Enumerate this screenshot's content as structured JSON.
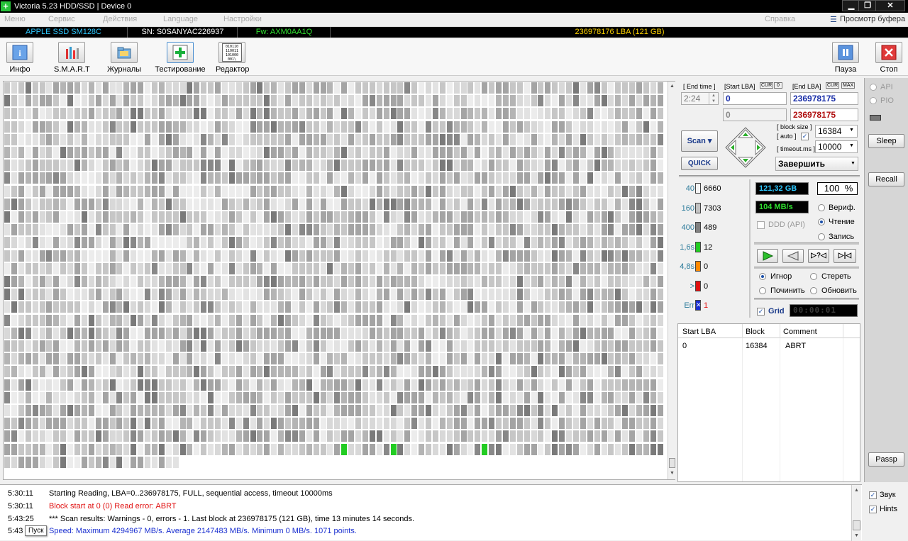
{
  "window": {
    "title": "Victoria 5.23 HDD/SSD | Device 0",
    "min": "▁",
    "max": "❐",
    "close": "✕"
  },
  "menu": {
    "items": [
      "Меню",
      "Сервис",
      "Действия",
      "Language",
      "Настройки"
    ],
    "help": "Справка",
    "clipboard": "Просмотр буфера"
  },
  "device": {
    "model": "APPLE SSD SM128C",
    "serial": "SN: S0SANYAC226937",
    "firmware": "Fw: AXM0AA1Q",
    "capacity": "236978176 LBA (121 GB)"
  },
  "toolbar": {
    "info": "Инфо",
    "smart": "S.M.A.R.T",
    "journals": "Журналы",
    "testing": "Тестирование",
    "editor": "Редактор",
    "pause": "Пауза",
    "stop": "Стоп",
    "editor_icon_text": "010110\n110011\n101000\n001\\"
  },
  "scan": {
    "end_time_label": "[ End time ]",
    "end_time": "2:24",
    "start_lba_label": "[Start LBA]",
    "cur_label": "CUR",
    "zero_label": "0",
    "end_lba_label": "[End LBA]",
    "max_label": "MAX",
    "start_lba": "0",
    "end_lba": "236978175",
    "cur_start": "0",
    "cur_end": "236978175",
    "scan_button": "Scan ▾",
    "quick_button": "QUICK",
    "block_size_label": "[ block size ]",
    "auto_label": "[ auto ]",
    "block_size": "16384",
    "timeout_label": "[ timeout.ms ]",
    "timeout": "10000",
    "finish_select": "Завершить"
  },
  "stats": {
    "legend": [
      {
        "label": "40",
        "value": "6660",
        "color": "#f4f4f4"
      },
      {
        "label": "160",
        "value": "7303",
        "color": "#c2c2c2"
      },
      {
        "label": "400",
        "value": "489",
        "color": "#808080"
      },
      {
        "label": "1,6s",
        "value": "12",
        "color": "#22cc22"
      },
      {
        "label": "4,8s",
        "value": "0",
        "color": "#ff8800"
      },
      {
        "label": ">",
        "value": "0",
        "color": "#e01010"
      },
      {
        "label": "Err",
        "value": "1",
        "color": "#1a2fd0"
      }
    ],
    "capacity_read": "121,32 GB",
    "percent": "100",
    "percent_sign": "%",
    "speed": "104 MB/s",
    "ddd": "DDD (API)",
    "verify": "Вериф.",
    "read": "Чтение",
    "write": "Запись",
    "ignore": "Игнор",
    "erase": "Стереть",
    "repair": "Починить",
    "refresh": "Обновить",
    "grid": "Grid",
    "timer": "00:00:01"
  },
  "results": {
    "headers": [
      "Start LBA",
      "Block",
      "Comment"
    ],
    "rows": [
      [
        "0",
        "16384",
        "ABRT"
      ]
    ]
  },
  "side": {
    "api": "API",
    "pio": "PIO",
    "sleep": "Sleep",
    "recall": "Recall",
    "passp": "Passp",
    "sound": "Звук",
    "hints": "Hints"
  },
  "log": [
    {
      "time": "5:30:11",
      "text": "Starting Reading, LBA=0..236978175, FULL, sequential access, timeout 10000ms",
      "color": "#000000"
    },
    {
      "time": "5:30:11",
      "text": "Block start at 0 (0) Read error: ABRT",
      "color": "#e01010"
    },
    {
      "time": "5:43:25",
      "text": "*** Scan results: Warnings - 0, errors - 1. Last block at 236978175 (121 GB), time 13 minutes 14 seconds.",
      "color": "#000000"
    },
    {
      "time": "5:43",
      "text": "Speed: Maximum 4294967 MB/s. Average 2147483 MB/s. Minimum 0 MB/s. 1071 points.",
      "color": "#1a2fd0"
    }
  ],
  "tooltip": "Пуск"
}
